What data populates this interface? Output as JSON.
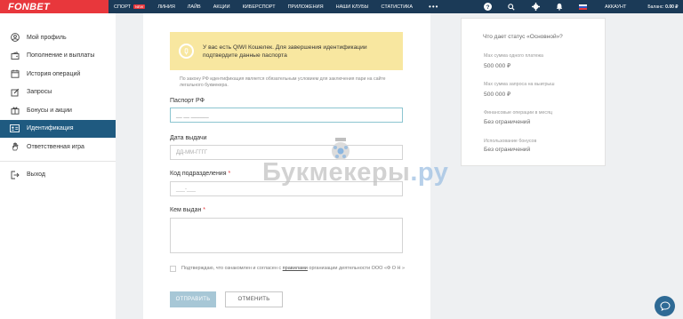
{
  "header": {
    "logo": "FONBET",
    "nav": [
      {
        "label": "СПОРТ",
        "badge": "NEW"
      },
      {
        "label": "ЛИНИЯ"
      },
      {
        "label": "ЛАЙВ"
      },
      {
        "label": "АКЦИИ"
      },
      {
        "label": "КИБЕРСПОРТ"
      },
      {
        "label": "ПРИЛОЖЕНИЯ"
      },
      {
        "label": "НАШИ КЛУБЫ"
      },
      {
        "label": "СТАТИСТИКА"
      }
    ],
    "more": "•••",
    "account": "АККАУНТ",
    "balance_label": "Баланс:",
    "balance_value": "0.00 ₽",
    "icons": [
      "help-icon",
      "search-icon",
      "settings-icon",
      "bell-icon",
      "flag-ru-icon"
    ]
  },
  "sidebar": {
    "items": [
      {
        "label": "Мой профиль",
        "icon": "user-icon"
      },
      {
        "label": "Пополнение и выплаты",
        "icon": "wallet-icon"
      },
      {
        "label": "История операций",
        "icon": "calendar-icon"
      },
      {
        "label": "Запросы",
        "icon": "edit-icon"
      },
      {
        "label": "Бонусы и акции",
        "icon": "gift-icon"
      },
      {
        "label": "Идентификация",
        "icon": "id-card-icon",
        "active": true
      },
      {
        "label": "Ответственная игра",
        "icon": "hand-icon"
      }
    ],
    "logout": {
      "label": "Выход",
      "icon": "logout-icon"
    }
  },
  "form": {
    "notice": "У вас есть QIWI Кошелек. Для завершения идентификации подтвердите данные паспорта",
    "law_note": "По закону РФ идентификация является обязательным условием для заключения пари на сайте легального букмекера.",
    "passport_label": "Паспорт РФ",
    "passport_value": "__ __ ______",
    "date_label": "Дата выдачи",
    "date_placeholder": "ДД-ММ-ГГГГ",
    "code_label": "Код подразделения",
    "code_placeholder": "___-___",
    "issuer_label": "Кем выдан",
    "required_mark": "*",
    "consent_text_1": "Подтверждаю, что ознакомлен и согласен с",
    "consent_link": "правилами",
    "consent_text_2": "организации деятельности ООО «Ф О Н »",
    "submit": "ОТПРАВИТЬ",
    "cancel": "ОТМЕНИТЬ"
  },
  "status_panel": {
    "title": "Что дает статус «Основной»?",
    "rows": [
      {
        "label": "Max сумма одного платежа",
        "value": "500 000 ₽"
      },
      {
        "label": "Max сумма запроса на выигрыш",
        "value": "500 000 ₽"
      },
      {
        "label": "Финансовые операции в месяц",
        "value": "Без ограничений"
      },
      {
        "label": "Использование бонусов",
        "value": "Без ограничений"
      }
    ]
  },
  "watermark": {
    "name": "Букмекеры",
    "domain": ".ру"
  },
  "colors": {
    "header": "#1b3a57",
    "brand": "#e8373c",
    "active": "#1f5a80",
    "notice": "#f8e7a0"
  }
}
